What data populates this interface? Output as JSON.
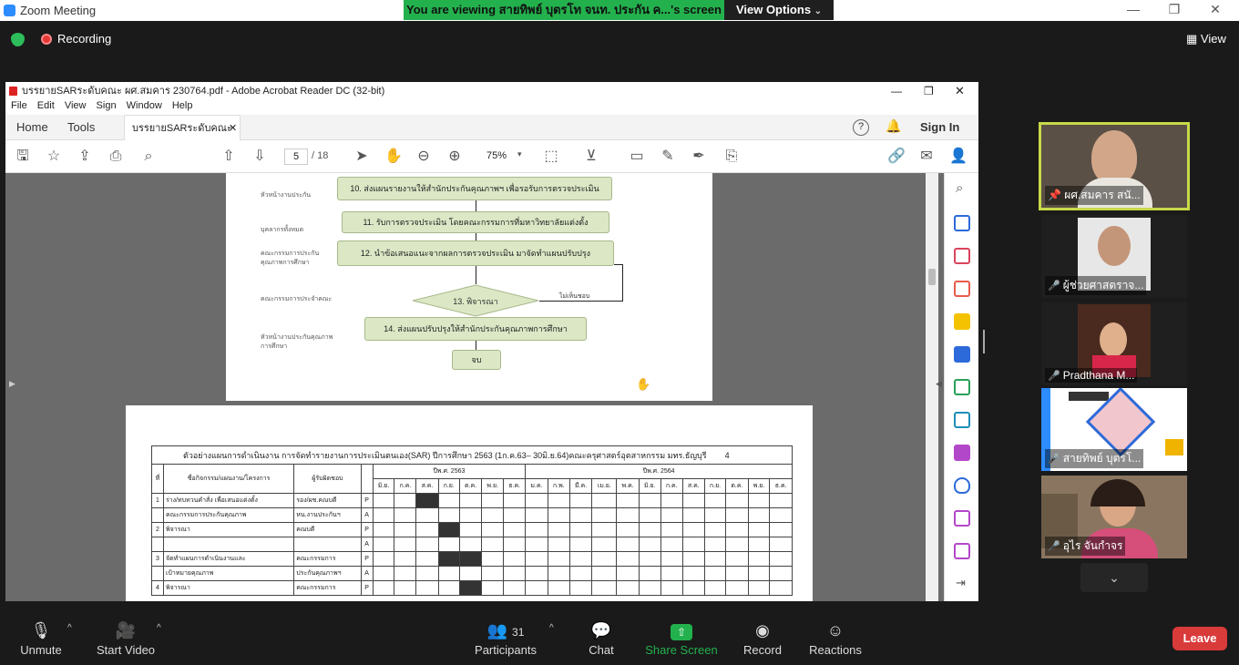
{
  "window": {
    "title": "Zoom Meeting",
    "banner": "You are viewing สายทิพย์ บุตรโท จนท. ประกัน ค...'s screen",
    "view_options": "View Options"
  },
  "meeting": {
    "recording": "Recording",
    "view": "View"
  },
  "acrobat": {
    "title": "บรรยายSARระดับคณะ ผศ.สมคาร 230764.pdf - Adobe Acrobat Reader DC (32-bit)",
    "menu": [
      "File",
      "Edit",
      "View",
      "Sign",
      "Window",
      "Help"
    ],
    "tabs": {
      "home": "Home",
      "tools": "Tools",
      "doc": "บรรยายSARระดับคณะ ..."
    },
    "sign_in": "Sign In",
    "page_current": "5",
    "page_total": "/ 18",
    "zoom": "75%"
  },
  "flow": {
    "steps": [
      "10. ส่งแผนรายงานให้สำนักประกันคุณภาพฯ เพื่อรอรับการตรวจประเมิน",
      "11. รับการตรวจประเมิน โดยคณะกรรมการที่มหาวิทยาลัยแต่งตั้ง",
      "12. นำข้อเสนอแนะจากผลการตรวจประเมิน มาจัดทำแผนปรับปรุง",
      "13. พิจารณา",
      "14. ส่งแผนปรับปรุงให้สำนักประกันคุณภาพการศึกษา",
      "จบ"
    ],
    "labels": [
      "หัวหน้างานประกัน",
      "บุคลากรทั้งหมด",
      "คณะกรรมการประกันคุณภาพการศึกษา",
      "คณะกรรมการประจำคณะ",
      "หัวหน้างานประกันคุณภาพการศึกษา"
    ],
    "not_ok": "ไม่เห็นชอบ"
  },
  "schedule": {
    "title": "ตัวอย่างแผนการดำเนินงาน การจัดทำรายงานการประเมินตนเอง(SAR) ปีการศึกษา 2563 (1ก.ค.63– 30มิ.ย.64)คณะครุศาสตร์อุตสาหกรรม มทร.ธัญบุรี",
    "page_no": "4",
    "col_no": "ที่",
    "col_activity": "ชื่อกิจกรรม/แผนงาน/โครงการ",
    "col_owner": "ผู้รับผิดชอบ",
    "year1": "ปีพ.ศ. 2563",
    "year2": "ปีพ.ศ. 2564",
    "months1": [
      "มิ.ย.",
      "ก.ค.",
      "ส.ค.",
      "ก.ย.",
      "ต.ค.",
      "พ.ย.",
      "ธ.ค."
    ],
    "months2": [
      "ม.ค.",
      "ก.พ.",
      "มี.ค.",
      "เม.ย.",
      "พ.ค.",
      "มิ.ย.",
      "ก.ค.",
      "ส.ค.",
      "ก.ย.",
      "ต.ค.",
      "พ.ย.",
      "ธ.ค."
    ],
    "rows": [
      {
        "no": "1",
        "act": "ร่าง/ทบทวนคำสั่ง เพื่อเสนอแต่งตั้ง",
        "owner": "รอง/ผช.คณบดี",
        "pa": "P"
      },
      {
        "no": "",
        "act": "คณะกรรมการประกันคุณภาพ",
        "owner": "หน.งานประกันฯ",
        "pa": "A"
      },
      {
        "no": "2",
        "act": "พิจารณา",
        "owner": "คณบดี",
        "pa": "P"
      },
      {
        "no": "",
        "act": "",
        "owner": "",
        "pa": "A"
      },
      {
        "no": "3",
        "act": "จัดทำแผนการดำเนินงานและ",
        "owner": "คณะกรรมการ",
        "pa": "P"
      },
      {
        "no": "",
        "act": "เป้าหมายคุณภาพ",
        "owner": "ประกันคุณภาพฯ",
        "pa": "A"
      },
      {
        "no": "4",
        "act": "พิจารณา",
        "owner": "คณะกรรมการ",
        "pa": "P"
      }
    ]
  },
  "participants": [
    {
      "name": "ผศ.สมคาร สนั..."
    },
    {
      "name": "ผู้ช่วยศาสตราจ..."
    },
    {
      "name": "Pradthana M..."
    },
    {
      "name": "สายทิพย์ บุตรโ..."
    },
    {
      "name": "อุไร จันกำจร"
    }
  ],
  "controls": {
    "unmute": "Unmute",
    "start_video": "Start Video",
    "participants": "Participants",
    "participants_count": "31",
    "chat": "Chat",
    "share_screen": "Share Screen",
    "record": "Record",
    "reactions": "Reactions",
    "leave": "Leave"
  },
  "colors": {
    "share_green": "#23b14d",
    "leave_red": "#d93a3a",
    "zoom_blue": "#2d8cff"
  }
}
